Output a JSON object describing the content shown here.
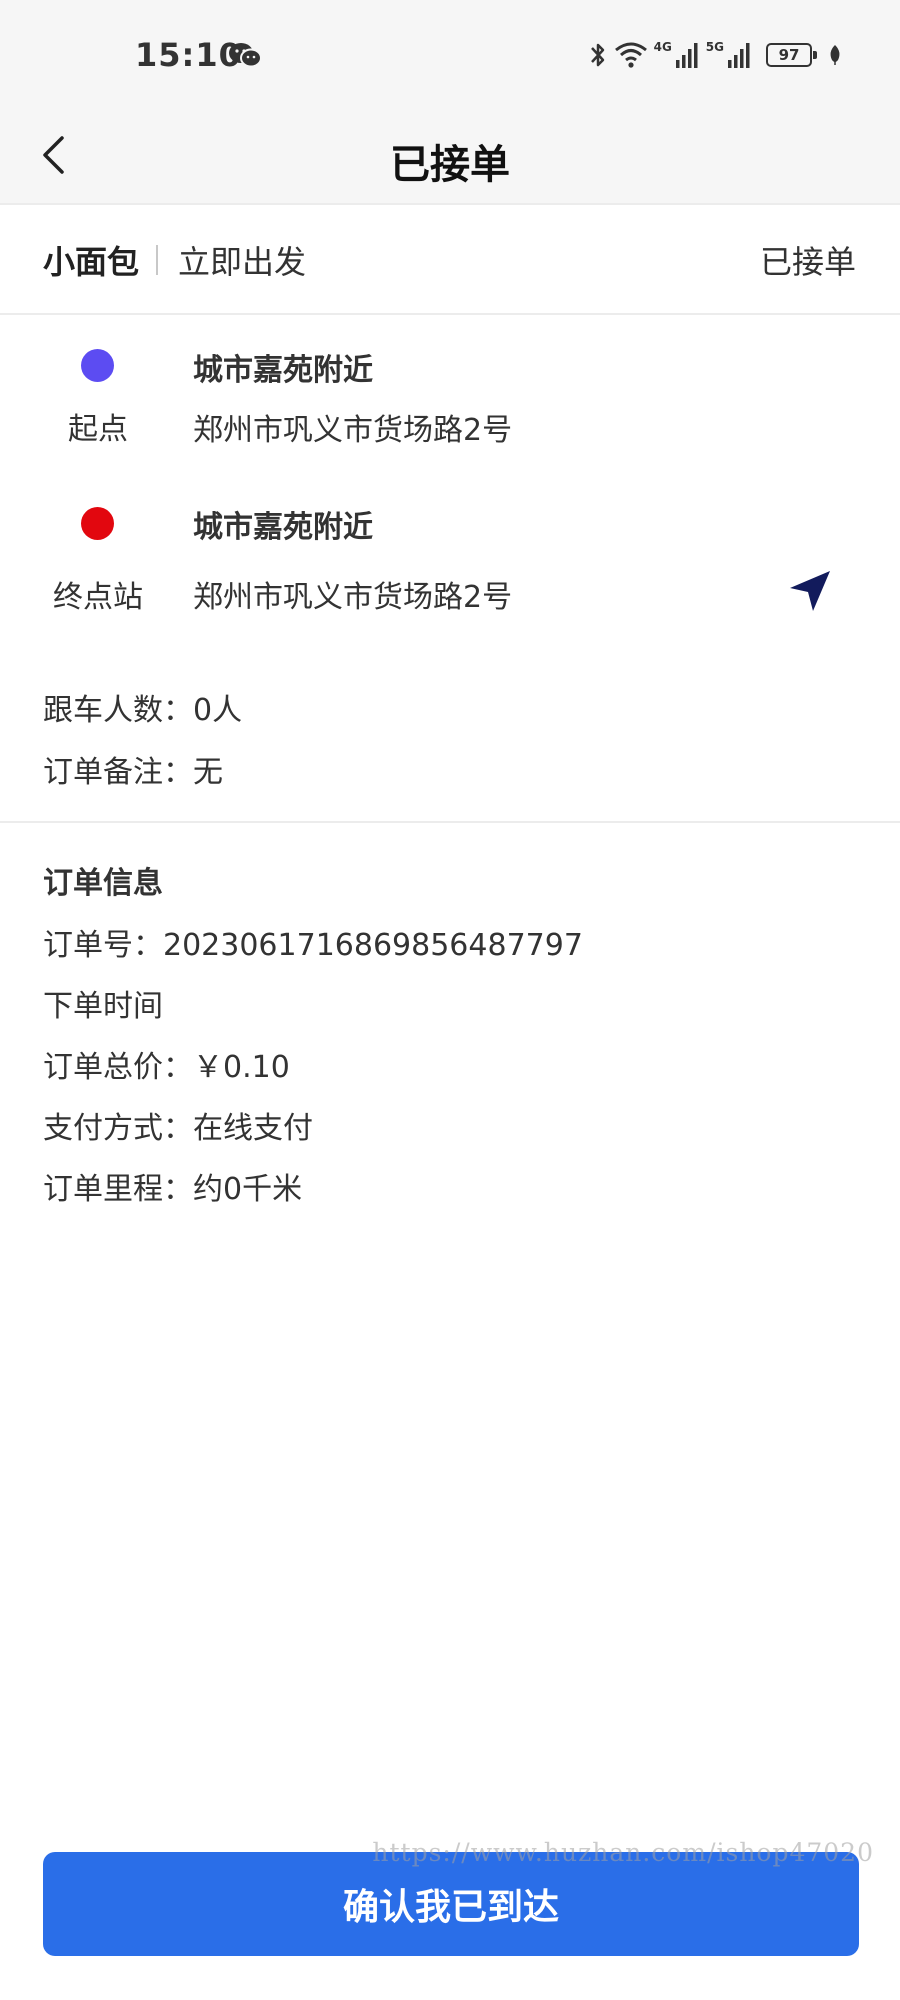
{
  "status_bar": {
    "time": "15:10",
    "net_4g": "4G",
    "net_5g": "5G",
    "battery": "97"
  },
  "header": {
    "title": "已接单"
  },
  "order_head": {
    "vehicle_type": "小面包",
    "depart_time": "立即出发",
    "status": "已接单"
  },
  "route": {
    "start": {
      "label": "起点",
      "name": "城市嘉苑附近",
      "address": "郑州市巩义市货场路2号",
      "color": "#5c4cf2"
    },
    "end": {
      "label": "终点站",
      "name": "城市嘉苑附近",
      "address": "郑州市巩义市货场路2号",
      "color": "#e2070f"
    }
  },
  "extras": {
    "passengers": "跟车人数：0人",
    "remark": "订单备注：无"
  },
  "order_info": {
    "title": "订单信息",
    "order_no": "订单号：2023061716869856487797",
    "order_time": "下单时间",
    "total_price": "订单总价：￥0.10",
    "payment": "支付方式：在线支付",
    "mileage": "订单里程：约0千米"
  },
  "watermark": "https://www.huzhan.com/ishop47020",
  "actions": {
    "confirm_label": "确认我已到达",
    "accent": "#2a6ee8"
  }
}
